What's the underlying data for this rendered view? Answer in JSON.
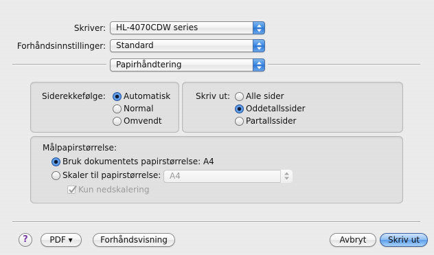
{
  "printer": {
    "label": "Skriver:",
    "value": "HL-4070CDW series"
  },
  "presets": {
    "label": "Forhåndsinnstillinger:",
    "value": "Standard"
  },
  "panel": {
    "value": "Papirhåndtering"
  },
  "page_order": {
    "label": "Siderekkefølge:",
    "options": [
      {
        "label": "Automatisk",
        "selected": true
      },
      {
        "label": "Normal",
        "selected": false
      },
      {
        "label": "Omvendt",
        "selected": false
      }
    ]
  },
  "print": {
    "label": "Skriv ut:",
    "options": [
      {
        "label": "Alle sider",
        "selected": false
      },
      {
        "label": "Oddetallssider",
        "selected": true
      },
      {
        "label": "Partallssider",
        "selected": false
      }
    ]
  },
  "dest_paper": {
    "label": "Målpapirstørrelse:",
    "use_doc": {
      "label": "Bruk dokumentets papirstørrelse: A4",
      "selected": true
    },
    "scale": {
      "label": "Skaler til papirstørrelse:",
      "selected": false,
      "popup_value": "A4"
    },
    "scale_down": {
      "label": "Kun nedskalering",
      "checked": true
    }
  },
  "footer": {
    "help": "?",
    "pdf": "PDF ▾",
    "preview": "Forhåndsvisning",
    "cancel": "Avbryt",
    "print": "Skriv ut"
  }
}
